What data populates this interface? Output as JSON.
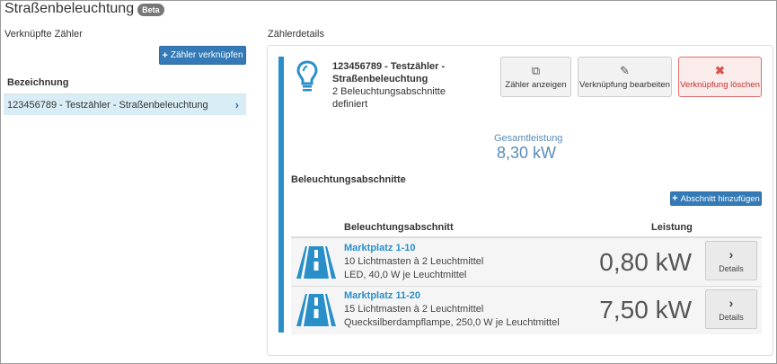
{
  "page": {
    "title": "Straßenbeleuchtung",
    "badge": "Beta"
  },
  "left": {
    "section_label": "Verknüpfte Zähler",
    "link_button": "Zähler verknüpfen",
    "column_header": "Bezeichnung",
    "meters": [
      {
        "label": "123456789 - Testzähler - Straßenbeleuchtung"
      }
    ]
  },
  "right": {
    "section_label": "Zählerdetails",
    "meter": {
      "name": "123456789 - Testzähler - Straßenbeleuchtung",
      "subtitle": "2 Beleuchtungsabschnitte definiert"
    },
    "actions": {
      "show": "Zähler anzeigen",
      "edit": "Verknüpfung bearbeiten",
      "delete": "Verknüpfung löschen"
    },
    "total": {
      "label": "Gesamtleistung",
      "value": "8,30 kW"
    },
    "sections_title": "Beleuchtungsabschnitte",
    "add_section": "Abschnitt hinzufügen",
    "table": {
      "col_section": "Beleuchtungsabschnitt",
      "col_power": "Leistung",
      "rows": [
        {
          "name": "Marktplatz 1-10",
          "line1": "10 Lichtmasten à 2 Leuchtmittel",
          "line2": "LED, 40,0 W je Leuchtmittel",
          "power": "0,80 kW",
          "details": "Details"
        },
        {
          "name": "Marktplatz 11-20",
          "line1": "15 Lichtmasten à 2 Leuchtmittel",
          "line2": "Quecksilberdampflampe, 250,0 W je Leuchtmittel",
          "power": "7,50 kW",
          "details": "Details"
        }
      ]
    }
  },
  "colors": {
    "primary": "#337ab7",
    "accent": "#2a8fc9",
    "danger": "#d9534f",
    "selected_row": "#d9edf7"
  },
  "icons": {
    "meter": "lightbulb-icon",
    "section": "road-icon",
    "show": "external-link-icon",
    "edit": "edit-icon",
    "delete": "times-icon",
    "details": "chevron-right-icon",
    "add": "plus-icon"
  }
}
